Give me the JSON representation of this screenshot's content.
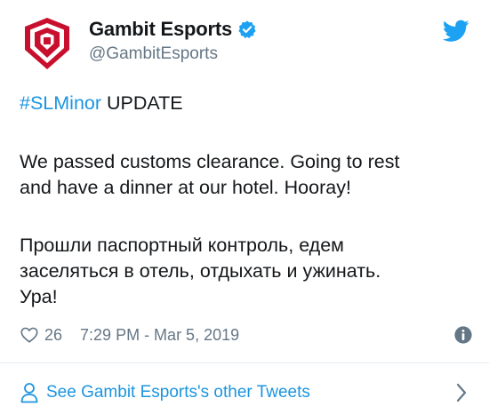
{
  "tweet": {
    "author": {
      "name": "Gambit Esports",
      "handle": "@GambitEsports",
      "verified": true,
      "avatar_icon": "gambit-logo",
      "avatar_color": "#c8102e"
    },
    "text": {
      "hashtag": "#SLMinor",
      "headline_rest": " UPDATE",
      "en_lines": [
        "We passed customs clearance. Going to rest",
        "and have a dinner at our hotel. Hooray!"
      ],
      "ru_lines": [
        "Прошли паспортный контроль, едем",
        "заселяться в отель, отдыхать и ужинать.",
        "Ура!"
      ]
    },
    "likes": "26",
    "timestamp": "7:29 PM - Mar 5, 2019",
    "footer_link": "See Gambit Esports's other Tweets"
  },
  "colors": {
    "link": "#1b95e0",
    "secondary_text": "#657786",
    "primary_text": "#14171a",
    "twitter_blue": "#1da1f2"
  },
  "icons": [
    "gambit-logo",
    "verified-badge-icon",
    "twitter-bird-icon",
    "heart-icon",
    "info-icon",
    "person-icon",
    "chevron-right-icon"
  ]
}
